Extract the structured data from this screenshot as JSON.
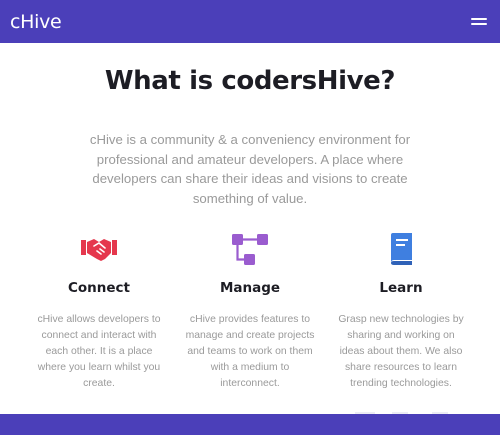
{
  "navbar": {
    "brand": "cHive",
    "menu_icon": "hamburger-icon"
  },
  "main": {
    "heading": "What is codersHive?",
    "intro": "cHive is a community & a conveniency environment for professional and amateur developers. A place where developers can share their ideas and visions to create something of value."
  },
  "features": [
    {
      "icon": "handshake-icon",
      "title": "Connect",
      "description": "cHive allows developers to connect and interact with each other. It is a place where you learn whilst you create."
    },
    {
      "icon": "workflow-icon",
      "title": "Manage",
      "description": "cHive provides features to manage and create projects and teams to work on them with a medium to interconnect."
    },
    {
      "icon": "book-icon",
      "title": "Learn",
      "description": "Grasp new technologies by sharing and working on ideas about them. We also share resources to learn trending technologies."
    }
  ],
  "colors": {
    "brand": "#4b3fb9",
    "connect_icon": "#e5374d",
    "manage_icon": "#9a5ccf",
    "learn_icon": "#3f7fe0"
  }
}
